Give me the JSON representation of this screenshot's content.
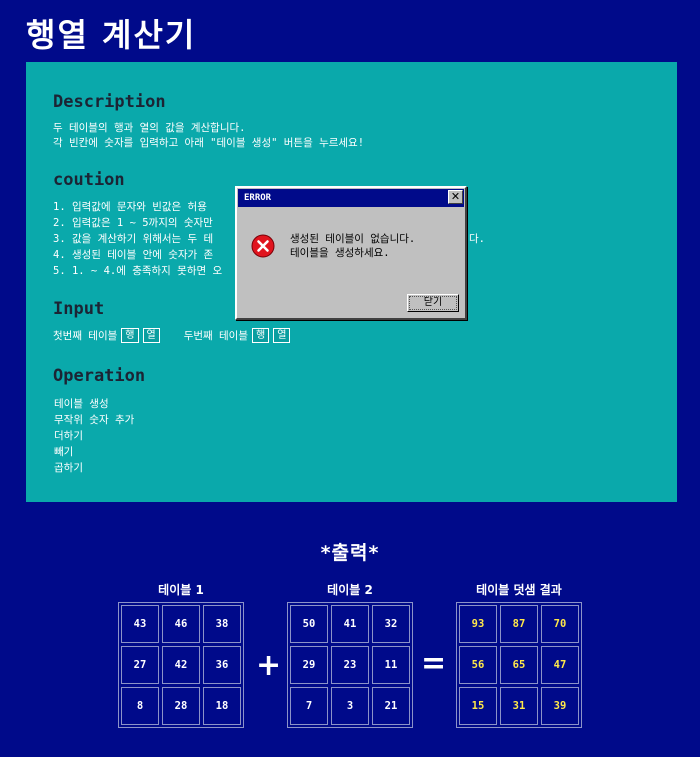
{
  "app": {
    "title": "행열 계산기"
  },
  "description": {
    "heading": "Description",
    "lines": [
      "두 테이블의 행과 열의 값을 계산합니다.",
      "각 빈칸에 숫자를 입력하고 아래 \"테이블 생성\" 버튼을 누르세요!"
    ]
  },
  "caution": {
    "heading": "coution",
    "lines": [
      "1. 입력값에 문자와 빈값은 허용",
      "2. 입력값은 1 ~ 5까지의 숫자만",
      "3. 값을 계산하기 위해서는 두 테",
      "4. 생성된 테이블 안에 숫자가 존",
      "5. 1. ~ 4.에 충족하지 못하면 오"
    ],
    "right_fragment": "다."
  },
  "input": {
    "heading": "Input",
    "first_label": "첫번째 테이블",
    "second_label": "두번째 테이블",
    "row_btn": "행",
    "col_btn": "열"
  },
  "operation": {
    "heading": "Operation",
    "items": [
      "테이블 생성",
      "무작위 숫자 추가",
      "더하기",
      "빼기",
      "곱하기"
    ]
  },
  "dialog": {
    "title": "ERROR",
    "close_glyph": "✕",
    "message": [
      "생성된 테이블이 없습니다.",
      "테이블을 생성하세요."
    ],
    "ok_label": "닫기"
  },
  "output": {
    "title": "*출력*",
    "table1_label": "테이블 1",
    "table2_label": "테이블 2",
    "result_label": "테이블 덧샘 결과",
    "plus": "+",
    "equals": "=",
    "table1": [
      [
        43,
        46,
        38
      ],
      [
        27,
        42,
        36
      ],
      [
        8,
        28,
        18
      ]
    ],
    "table2": [
      [
        50,
        41,
        32
      ],
      [
        29,
        23,
        11
      ],
      [
        7,
        3,
        21
      ]
    ],
    "result": [
      [
        93,
        87,
        70
      ],
      [
        56,
        65,
        47
      ],
      [
        15,
        31,
        39
      ]
    ]
  },
  "colors": {
    "background": "#000a8a",
    "panel": "#0aa9ab",
    "heading": "#1c2434",
    "result_text": "#ffe84a",
    "error_icon": "#e0141e"
  },
  "icons": {
    "dialog_icon": "error-icon"
  }
}
